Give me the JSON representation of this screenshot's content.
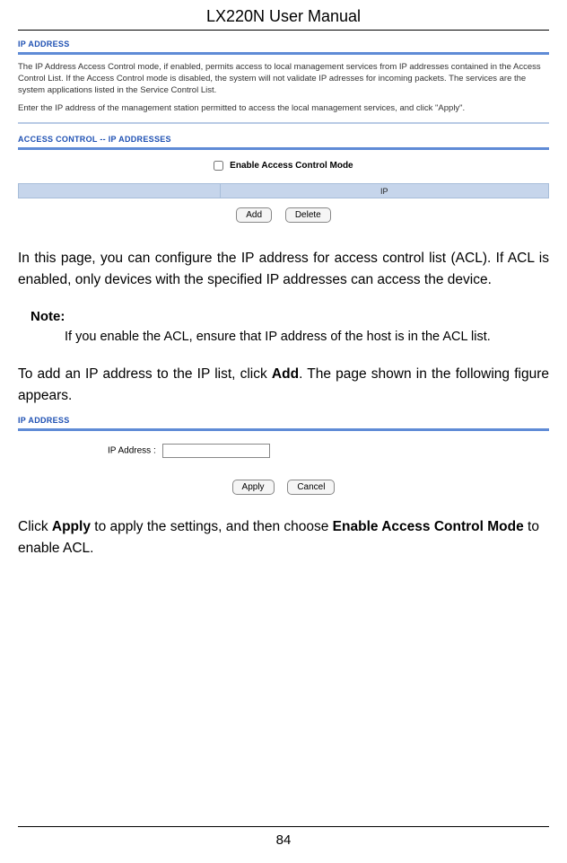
{
  "header": {
    "title": "LX220N User Manual"
  },
  "fig1": {
    "section1_label": "IP ADDRESS",
    "desc1": "The IP Address Access Control mode, if enabled, permits access to local management services from IP addresses contained in the Access Control List. If the Access Control mode is disabled, the system will not validate IP adresses for incoming packets. The services are the system applications listed in the Service Control List.",
    "desc2": "Enter the IP address of the management station permitted to access the local management services, and click \"Apply\".",
    "section2_label": "ACCESS CONTROL -- IP ADDRESSES",
    "enable_label": "Enable Access Control Mode",
    "table_header_ip": "IP",
    "btn_add": "Add",
    "btn_delete": "Delete"
  },
  "para1": "In this page, you can configure the IP address for access control list (ACL). If ACL is enabled, only devices with the specified IP addresses can access the device.",
  "note": {
    "label": "Note:",
    "text": "If you enable the ACL, ensure that IP address of the host is in the ACL list."
  },
  "para2_a": "To add an IP address to the IP list, click ",
  "para2_bold": "Add",
  "para2_b": ". The page shown in the following figure appears.",
  "fig2": {
    "section_label": "IP ADDRESS",
    "ip_label": "IP Address :",
    "btn_apply": "Apply",
    "btn_cancel": "Cancel"
  },
  "para3_a": "Click ",
  "para3_b1": "Apply",
  "para3_c": " to apply the settings, and then choose ",
  "para3_b2": "Enable Access Control Mode",
  "para3_d": " to enable ACL.",
  "footer": {
    "page_number": "84"
  }
}
